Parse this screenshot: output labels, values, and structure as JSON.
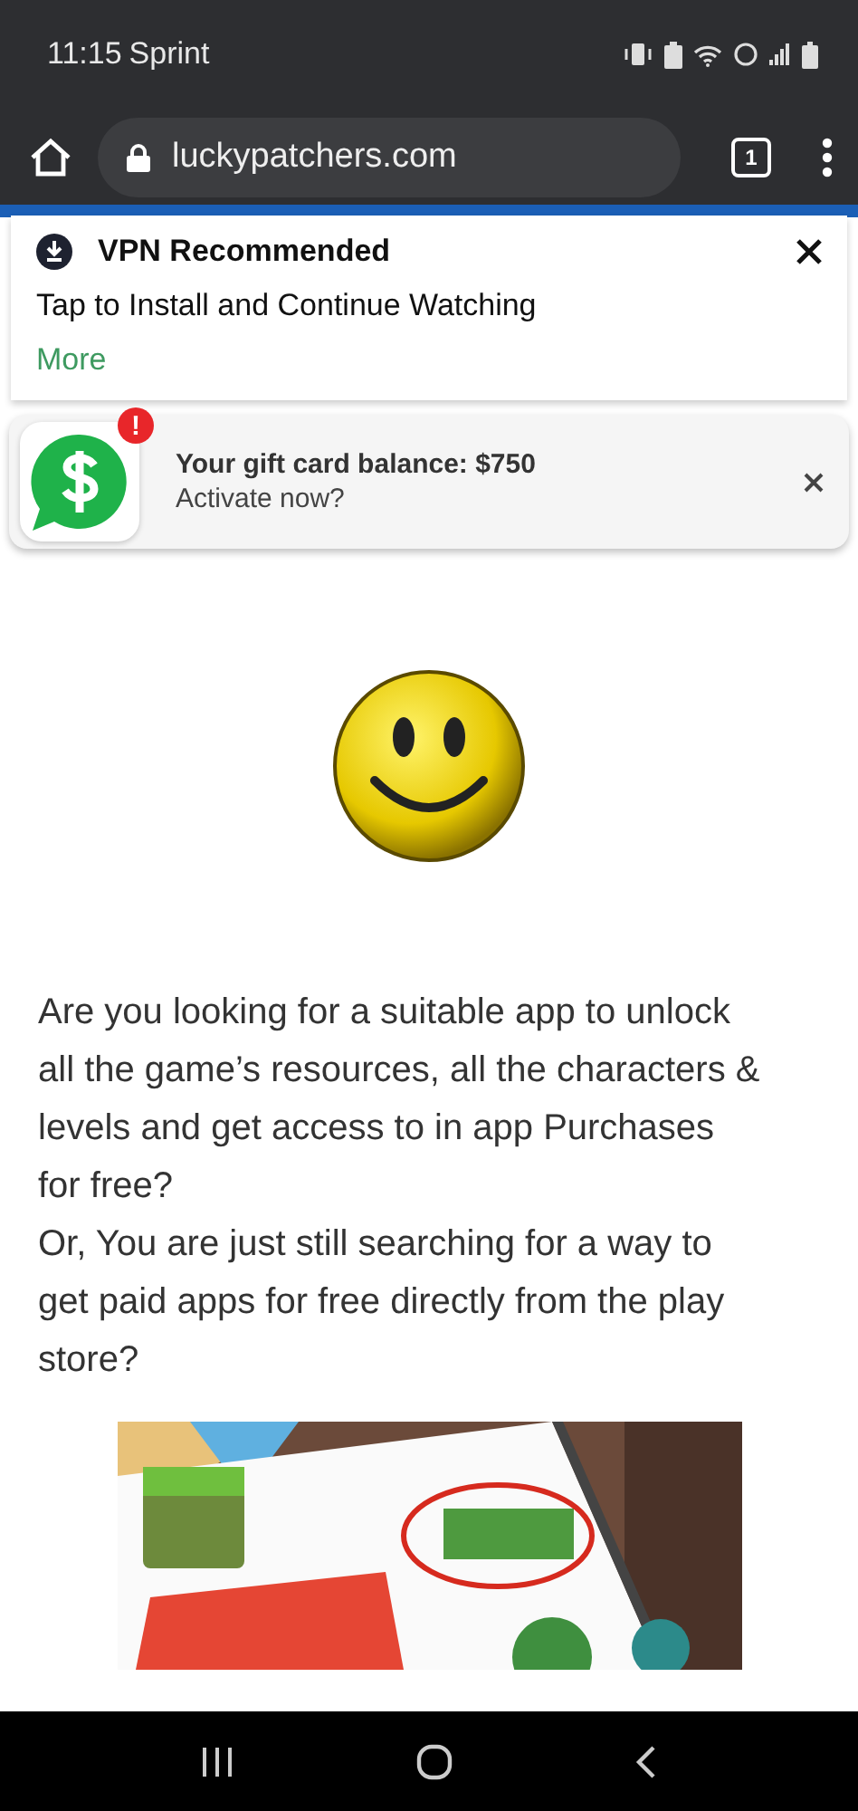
{
  "status_bar": {
    "time": "11:15",
    "carrier": "Sprint"
  },
  "browser": {
    "url": "luckypatchers.com",
    "tab_count": "1"
  },
  "vpn_notice": {
    "title": "VPN Recommended",
    "message": "Tap to Install and Continue Watching",
    "link": "More"
  },
  "gift_banner": {
    "title": "Your gift card balance: $750",
    "subtitle": "Activate now?",
    "alert": "!"
  },
  "article": {
    "paragraphs": [
      "Are you looking for a suitable app to unlock all the game’s resources, all the characters & levels and get access to in app Purchases for free?",
      "Or, You are just still searching for a way to get paid apps for free directly from the play store?"
    ]
  }
}
